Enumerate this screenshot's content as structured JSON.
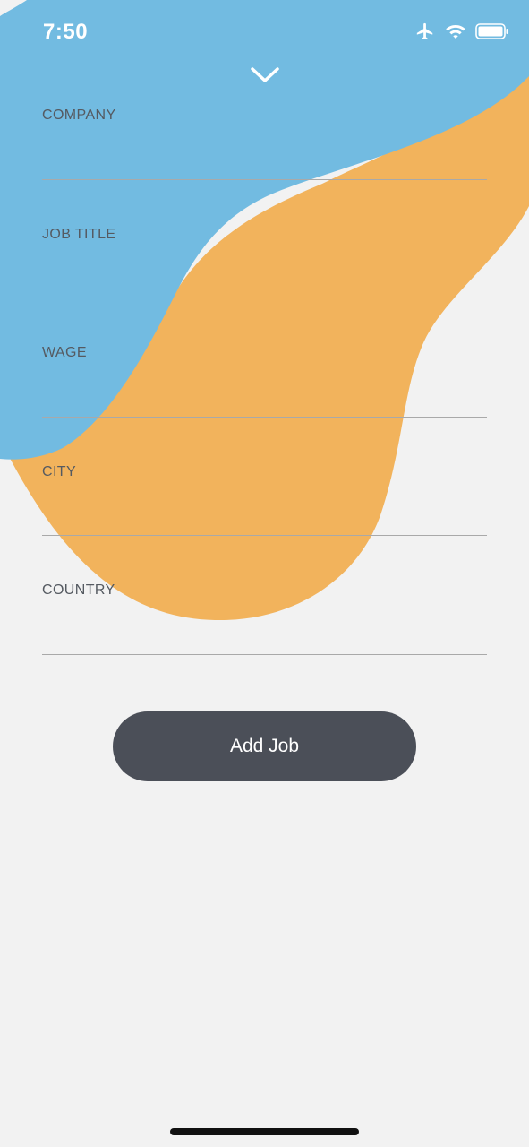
{
  "status_bar": {
    "time": "7:50",
    "icons": [
      "airplane-icon",
      "wifi-icon",
      "battery-icon"
    ]
  },
  "header": {
    "collapse_icon": "chevron-down-icon"
  },
  "form": {
    "fields": [
      {
        "label": "COMPANY",
        "value": ""
      },
      {
        "label": "JOB TITLE",
        "value": ""
      },
      {
        "label": "WAGE",
        "value": ""
      },
      {
        "label": "CITY",
        "value": ""
      },
      {
        "label": "COUNTRY",
        "value": ""
      }
    ]
  },
  "actions": {
    "add_job_label": "Add Job"
  },
  "colors": {
    "background": "#f2f2f2",
    "blob_blue": "#72bbe1",
    "blob_orange": "#f2b35c",
    "button": "#4b4f58",
    "divider": "#a9a9a9"
  }
}
